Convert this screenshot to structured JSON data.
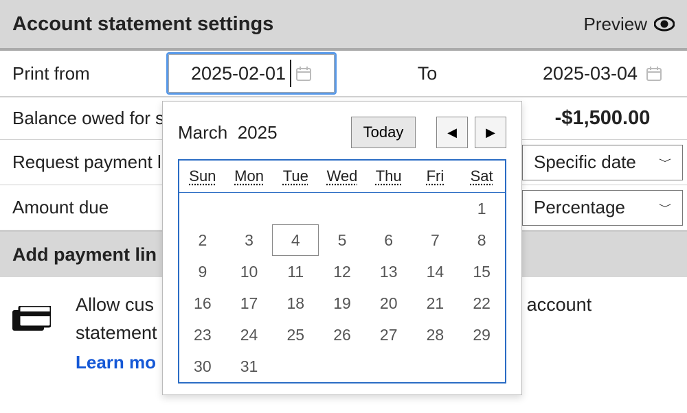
{
  "header": {
    "title": "Account statement settings",
    "preview_label": "Preview"
  },
  "print": {
    "label": "Print from",
    "from_value": "2025-02-01",
    "to_label": "To",
    "to_value": "2025-03-04"
  },
  "balance": {
    "label": "Balance owed for s",
    "value": "-$1,500.00"
  },
  "request": {
    "label": "Request payment l",
    "select_value": "Specific date"
  },
  "amount": {
    "label": "Amount due",
    "select_value": "Percentage"
  },
  "add_link": {
    "title": "Add payment lin"
  },
  "body": {
    "line": "Allow cus",
    "line2": "statement",
    "line_tail": "eir account",
    "learn": "Learn mo"
  },
  "picker": {
    "month": "March",
    "year": "2025",
    "today": "Today",
    "days": [
      "Sun",
      "Mon",
      "Tue",
      "Wed",
      "Thu",
      "Fri",
      "Sat"
    ],
    "leading_blanks": 6,
    "last_day": 31,
    "selected_day": 4
  }
}
